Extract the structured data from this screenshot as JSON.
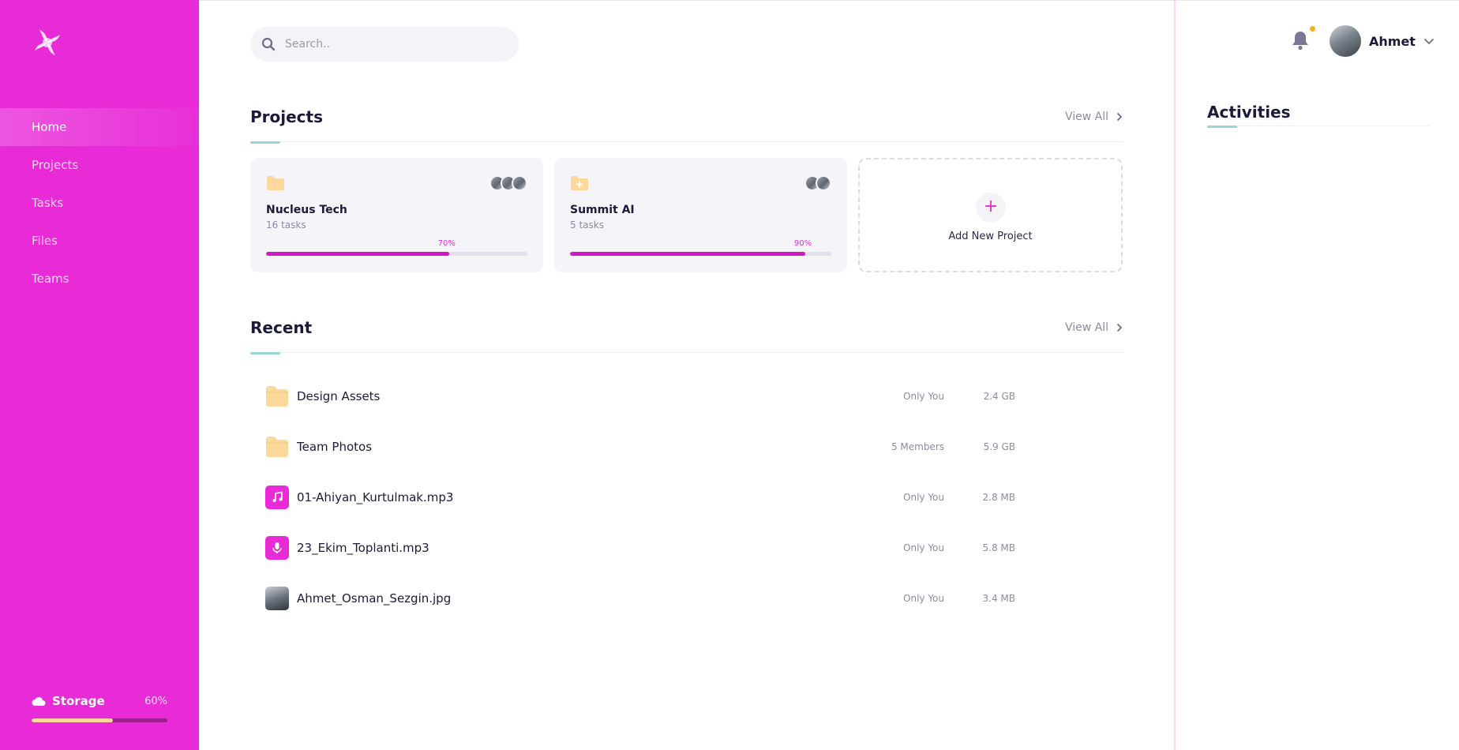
{
  "colors": {
    "brand": "#e82bd7",
    "progress": "#d417c4",
    "storage_fill": "#ffd79a",
    "folder": "#fcd99a",
    "accent_underline": "#9bd3dc"
  },
  "sidebar": {
    "logo_icon": "pinwheel-logo",
    "nav": [
      {
        "label": "Home",
        "active": true
      },
      {
        "label": "Projects"
      },
      {
        "label": "Tasks"
      },
      {
        "label": "Files"
      },
      {
        "label": "Teams"
      }
    ],
    "storage": {
      "icon": "cloud-icon",
      "label": "Storage",
      "percent_label": "60%",
      "fraction": 0.6
    }
  },
  "search": {
    "placeholder": "Search..",
    "icon": "search-icon"
  },
  "projects": {
    "title": "Projects",
    "view_all": "View All",
    "items": [
      {
        "name": "Nucleus Tech",
        "tasks": "16 tasks",
        "progress_label": "70%",
        "progress": 0.7,
        "members": 3
      },
      {
        "name": "Summit AI",
        "tasks": "5 tasks",
        "progress_label": "90%",
        "progress": 0.9,
        "members": 2
      }
    ],
    "add_label": "Add New Project",
    "add_icon": "+"
  },
  "recent": {
    "title": "Recent",
    "view_all": "View All",
    "files": [
      {
        "name": "Design Assets",
        "shared": "Only You",
        "size": "2.4 GB",
        "type": "folder"
      },
      {
        "name": "Team Photos",
        "shared": "5 Members",
        "size": "5.9 GB",
        "type": "folder"
      },
      {
        "name": "01-Ahiyan_Kurtulmak.mp3",
        "shared": "Only You",
        "size": "2.8 MB",
        "type": "music"
      },
      {
        "name": "23_Ekim_Toplanti.mp3",
        "shared": "Only You",
        "size": "5.8 MB",
        "type": "voice"
      },
      {
        "name": "Ahmet_Osman_Sezgin.jpg",
        "shared": "Only You",
        "size": "3.4 MB",
        "type": "photo"
      }
    ]
  },
  "header": {
    "user_name": "Ahmet",
    "notification_icon": "bell-icon"
  },
  "activities": {
    "title": "Activities"
  }
}
